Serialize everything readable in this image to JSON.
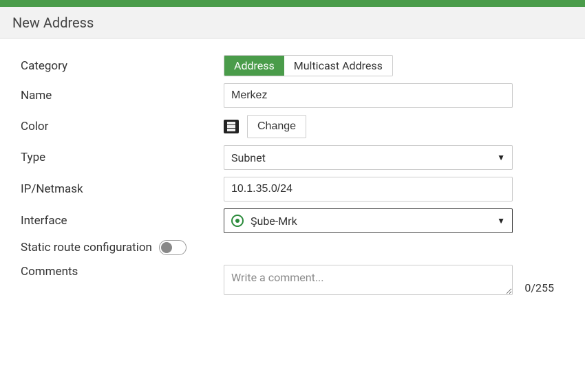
{
  "colors": {
    "accent": "#4a9c4a"
  },
  "title": "New Address",
  "labels": {
    "category": "Category",
    "name": "Name",
    "color": "Color",
    "type": "Type",
    "ip_netmask": "IP/Netmask",
    "interface": "Interface",
    "static_route": "Static route configuration",
    "comments": "Comments"
  },
  "category": {
    "options": {
      "address": "Address",
      "multicast": "Multicast Address"
    },
    "selected": "address"
  },
  "name": {
    "value": "Merkez"
  },
  "color_change_label": "Change",
  "type": {
    "value": "Subnet"
  },
  "ip_netmask": {
    "value": "10.1.35.0/24"
  },
  "interface": {
    "value": "Şube-Mrk"
  },
  "static_route": {
    "on": false
  },
  "comments": {
    "value": "",
    "placeholder": "Write a comment...",
    "counter": "0/255"
  }
}
